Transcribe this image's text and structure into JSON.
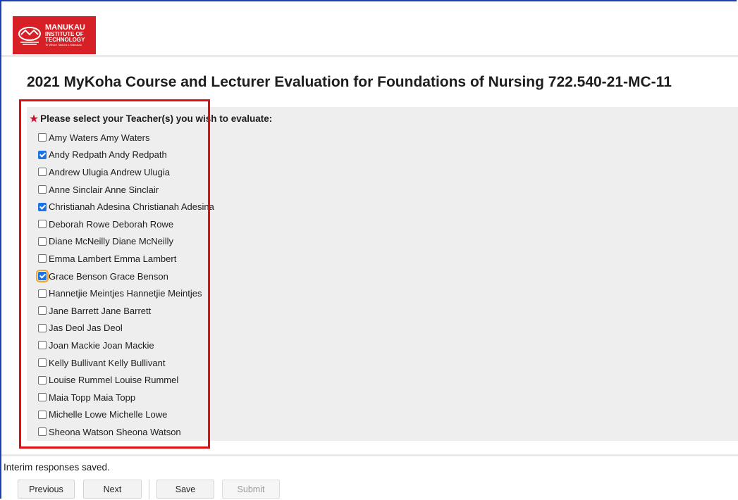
{
  "logo": {
    "line1": "MANUKAU",
    "line2": "INSTITUTE OF",
    "line3": "TECHNOLOGY",
    "tagline": "Te Whare Takiura o Manukau",
    "brand_color": "#d71f26"
  },
  "page": {
    "title": "2021 MyKoha Course and Lecturer Evaluation for Foundations of Nursing 722.540-21-MC-11"
  },
  "question": {
    "required_marker": "★",
    "label": "Please select your Teacher(s) you wish to evaluate:",
    "options": [
      {
        "label": "Amy Waters Amy Waters",
        "checked": false
      },
      {
        "label": "Andy Redpath Andy Redpath",
        "checked": true
      },
      {
        "label": "Andrew Ulugia Andrew Ulugia",
        "checked": false
      },
      {
        "label": "Anne Sinclair Anne Sinclair",
        "checked": false
      },
      {
        "label": "Christianah Adesina Christianah Adesina",
        "checked": true
      },
      {
        "label": "Deborah Rowe Deborah Rowe",
        "checked": false
      },
      {
        "label": "Diane McNeilly Diane McNeilly",
        "checked": false
      },
      {
        "label": "Emma Lambert Emma Lambert",
        "checked": false
      },
      {
        "label": "Grace Benson Grace Benson",
        "checked": true,
        "focused": true
      },
      {
        "label": "Hannetjie Meintjes Hannetjie Meintjes",
        "checked": false
      },
      {
        "label": "Jane Barrett Jane Barrett",
        "checked": false
      },
      {
        "label": "Jas Deol Jas Deol",
        "checked": false
      },
      {
        "label": "Joan Mackie Joan Mackie",
        "checked": false
      },
      {
        "label": "Kelly Bullivant Kelly Bullivant",
        "checked": false
      },
      {
        "label": "Louise Rummel Louise Rummel",
        "checked": false
      },
      {
        "label": "Maia Topp Maia Topp",
        "checked": false
      },
      {
        "label": "Michelle Lowe Michelle Lowe",
        "checked": false
      },
      {
        "label": "Sheona Watson Sheona Watson",
        "checked": false
      }
    ]
  },
  "status": {
    "message": "Interim responses saved."
  },
  "nav": {
    "previous_label": "Previous",
    "next_label": "Next",
    "save_label": "Save",
    "submit_label": "Submit",
    "submit_enabled": false
  },
  "colors": {
    "annotation_border": "#e01010",
    "checkbox_checked": "#1a73e8",
    "focus_ring": "#f5a623",
    "required_star": "#c8102e"
  }
}
